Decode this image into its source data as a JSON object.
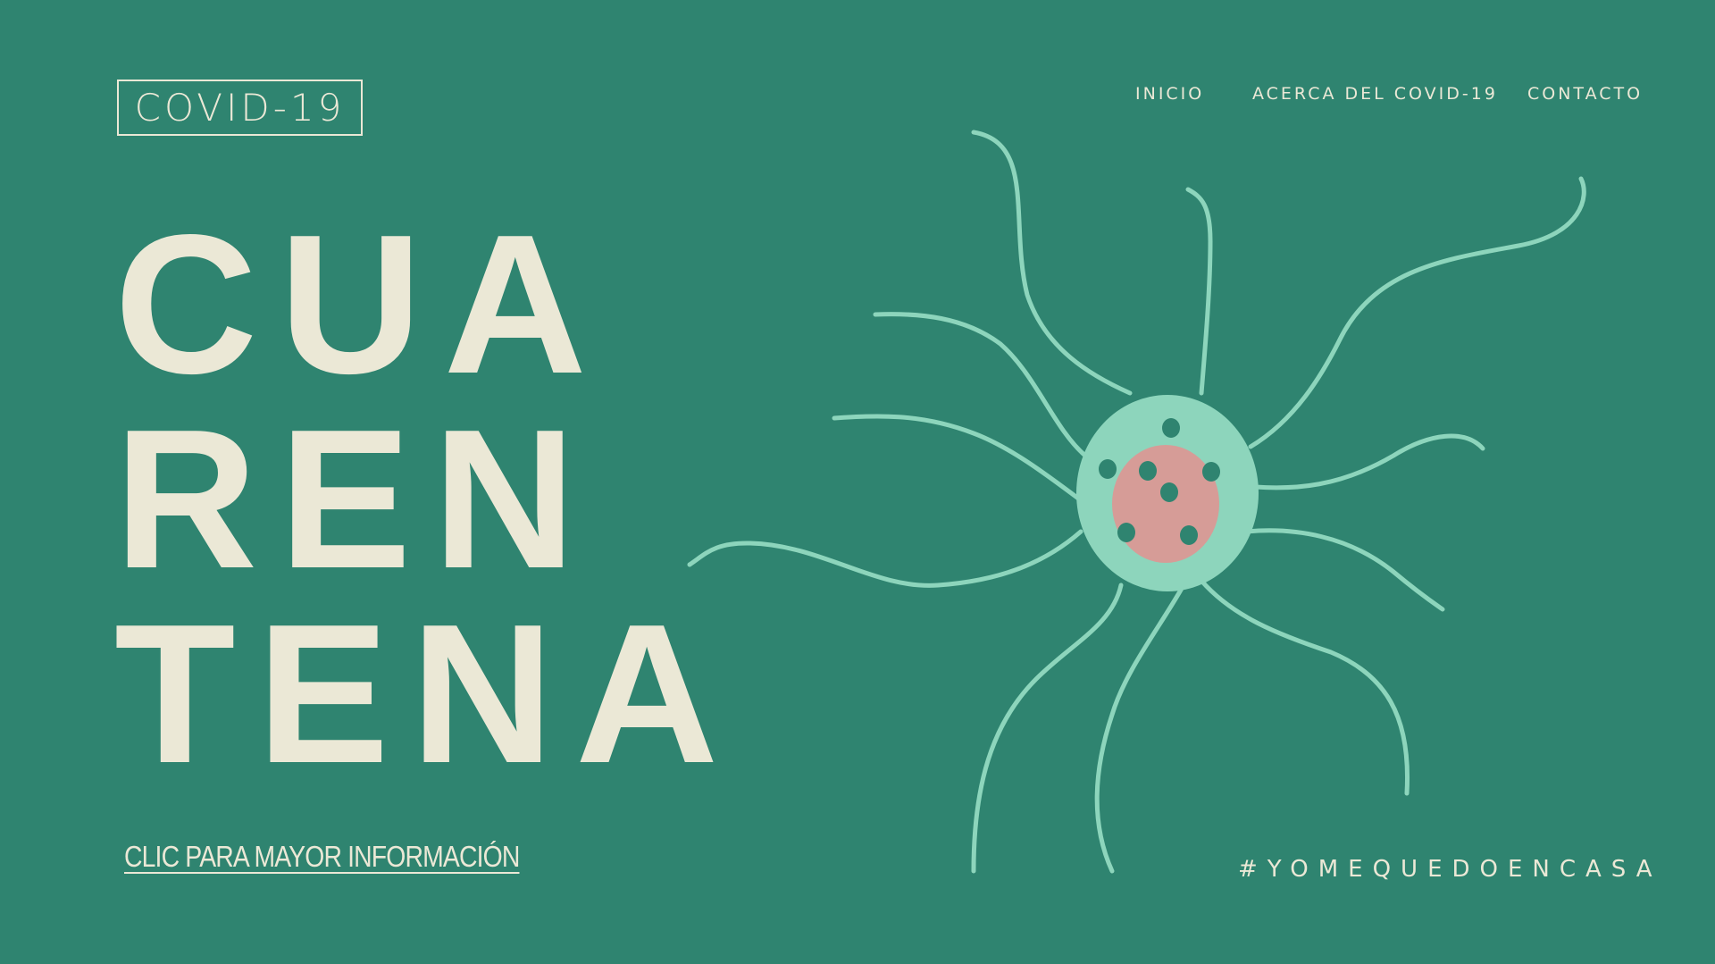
{
  "logo": {
    "label": "COVID-19"
  },
  "nav": {
    "items": [
      {
        "label": "INICIO"
      },
      {
        "label": "ACERCA DEL COVID-19"
      },
      {
        "label": "CONTACTO"
      }
    ]
  },
  "hero": {
    "headline_lines": [
      "CUA",
      "REN",
      "TENA"
    ],
    "cta_label": "CLIC PARA MAYOR INFORMACIÓN",
    "hashtag": "#YOMEQUEDOENCASA"
  },
  "colors": {
    "background": "#2f8470",
    "text": "#ebe8d6",
    "virus_body": "#8dd5bc",
    "virus_nucleus": "#d69c97",
    "virus_dots": "#2f8470"
  },
  "icons": {
    "illustration": "virus-cell-illustration"
  }
}
